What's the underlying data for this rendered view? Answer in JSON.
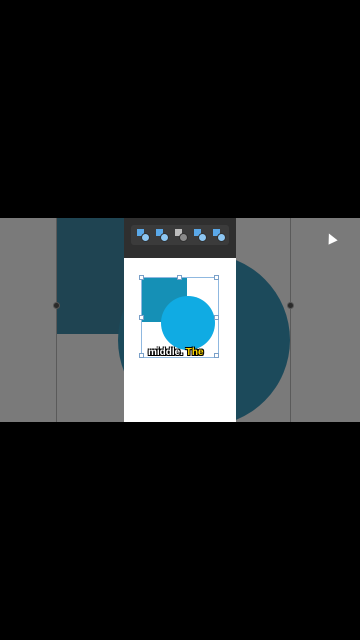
{
  "caption": {
    "plain": "middle.",
    "highlight": "The"
  },
  "toolbar": {
    "buttons": [
      {
        "icon": "bring-to-front-icon",
        "state": "normal"
      },
      {
        "icon": "send-to-back-icon",
        "state": "normal"
      },
      {
        "icon": "bring-forward-icon",
        "state": "disabled"
      },
      {
        "icon": "send-backward-icon",
        "state": "hover"
      },
      {
        "icon": "arrange-icon",
        "state": "normal"
      }
    ]
  },
  "colors": {
    "square": "#1590b6",
    "circle": "#10abe3",
    "toolbar": "#2f2f2f",
    "accent": "#5aa8e8",
    "highlight": "#ffd800"
  }
}
